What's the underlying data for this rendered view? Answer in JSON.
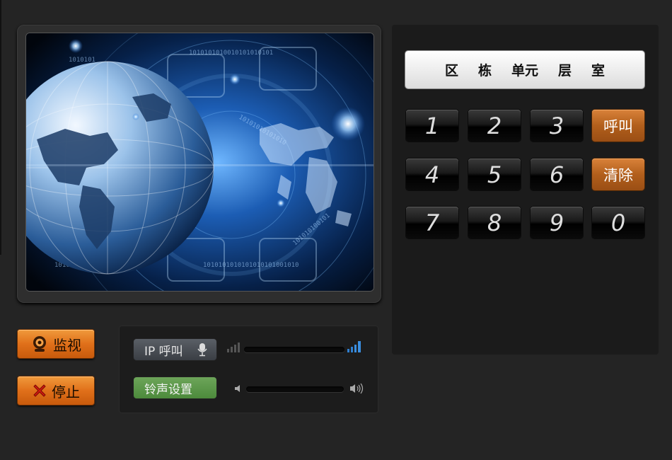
{
  "address": {
    "fields": [
      "区",
      "栋",
      "单元",
      "层",
      "室"
    ]
  },
  "keypad": {
    "rows": [
      [
        "1",
        "2",
        "3",
        "呼叫"
      ],
      [
        "4",
        "5",
        "6",
        "清除"
      ],
      [
        "7",
        "8",
        "9",
        "0"
      ]
    ]
  },
  "actions": {
    "monitor_label": "监视",
    "stop_label": "停止"
  },
  "controls": {
    "ip_call_label": "IP 呼叫",
    "ringtone_label": "铃声设置",
    "ip_call_volume": 0.0,
    "ringtone_volume": 0.0
  },
  "colors": {
    "accent_orange": "#e0701a",
    "key_orange": "#b25f1c",
    "ringtone_green": "#5a9848",
    "signal_blue": "#3a8ee0"
  },
  "icons": {
    "monitor": "webcam-icon",
    "stop": "red-x-icon",
    "ip_call": "microphone-icon",
    "ringtone_min": "speaker-low-icon",
    "ringtone_max": "speaker-high-icon"
  }
}
